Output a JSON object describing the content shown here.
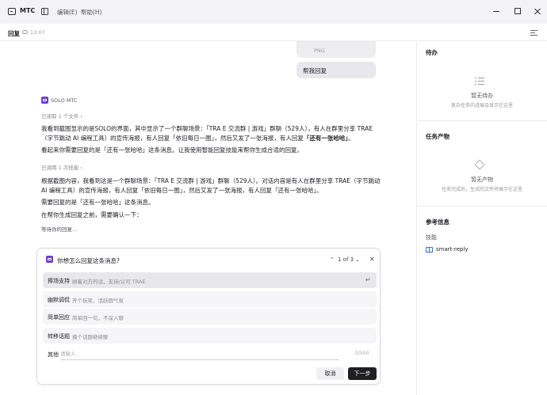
{
  "titlebar": {
    "app_name": "MTC",
    "menu": [
      "编辑(E)",
      "帮助(H)"
    ]
  },
  "session": {
    "title": "回复",
    "time": "13:07"
  },
  "chat": {
    "image_attachment_label": "PNG",
    "user_message": "帮我回复",
    "agent_name": "SOLO MTC",
    "step_read": "已读取 1 个文件",
    "para1_a": "我看到截图显示的是SOLO的界面，其中显示了一个群聊场景：「TRA E 交流群 | 游戏」群聊（529人），有人在群里分享 TRAE（字节跳动 AI 编程工具）的宣传海报，有人回复「依旧每日一图」，然后又发了一张海报，有人回复",
    "para1_b": "「还有一张哈哈」",
    "para1_c": "。",
    "para2": "看起来你需要回复的是「还有一张哈哈」这条消息。让我使用智能回复技能来帮你生成合适的回复。",
    "step_skill": "已调用 1 次技能",
    "para3": "根据截图内容，我看到这是一个群聊场景：「TRA E 交流群 | 游戏」群聊（529人）。对话内容是有人在群里分享 TRAE（字节跳动 AI 编程工具）的宣传海报，有人回复「依旧每日一图」，然后又发了一张海报，有人回复「还有一张哈哈」。",
    "para4": "需要回复的是「还有一张哈哈」这条消息。",
    "para5": "在帮你生成回复之前，需要确认一下：",
    "waiting": "等待你的回复..."
  },
  "question": {
    "title": "你想怎么回复这条消息?",
    "pager": "1 of 3",
    "options": [
      {
        "label": "捧场支持",
        "desc": "顺着对方的话，支持/认可 TRAE"
      },
      {
        "label": "幽默调侃",
        "desc": "开个玩笑，活跃群气氛"
      },
      {
        "label": "简单回应",
        "desc": "简单回一句，不深入聊"
      },
      {
        "label": "转移话题",
        "desc": "换个话题继续聊"
      }
    ],
    "other_label": "其他",
    "other_placeholder": "请输入",
    "char_count": "0/500",
    "cancel_label": "取消",
    "next_label": "下一步"
  },
  "right_panel": {
    "todo_title": "待办",
    "todo_empty": "暂无待办",
    "todo_desc": "复杂任务的进展会显示在这里",
    "artifacts_title": "任务产物",
    "artifacts_empty": "暂无产物",
    "artifacts_desc": "任务完成后，生成的文件将展示在这里",
    "reference_title": "参考信息",
    "skills_label": "技能",
    "skill_name": "smart-reply"
  },
  "icons": {
    "window": [
      "minimize-icon",
      "maximize-icon",
      "close-icon"
    ],
    "accent": "#6b3fd6",
    "link": "#2f6fde"
  }
}
